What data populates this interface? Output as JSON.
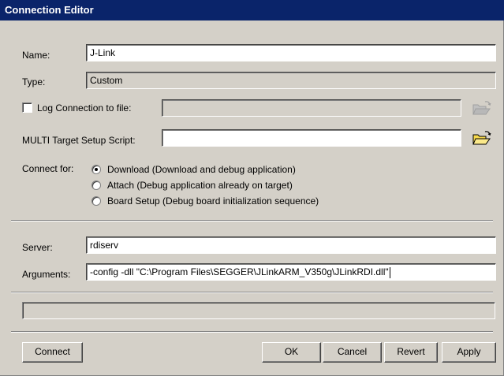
{
  "window": {
    "title": "Connection Editor"
  },
  "form": {
    "name_label": "Name:",
    "name_value": "J-Link",
    "type_label": "Type:",
    "type_value": "Custom",
    "log_label": "Log Connection to file:",
    "log_checked": false,
    "log_value": "",
    "setup_script_label": "MULTI Target Setup Script:",
    "setup_script_value": "",
    "connect_for_label": "Connect for:",
    "connect_options": [
      {
        "label": "Download (Download and debug application)",
        "selected": true
      },
      {
        "label": "Attach (Debug application already on target)",
        "selected": false
      },
      {
        "label": "Board Setup (Debug board initialization sequence)",
        "selected": false
      }
    ],
    "server_label": "Server:",
    "server_value": "rdiserv",
    "arguments_label": "Arguments:",
    "arguments_value": "-config -dll \"C:\\Program Files\\SEGGER\\JLinkARM_V350g\\JLinkRDI.dll\"",
    "status_value": ""
  },
  "buttons": {
    "connect": "Connect",
    "ok": "OK",
    "cancel": "Cancel",
    "revert": "Revert",
    "apply": "Apply"
  },
  "icons": {
    "log_browse": "folder-open-icon-disabled",
    "script_browse": "folder-open-icon"
  },
  "colors": {
    "title_bar": "#0a246a",
    "face": "#d4d0c8",
    "folder_yellow": "#f6d84a"
  }
}
